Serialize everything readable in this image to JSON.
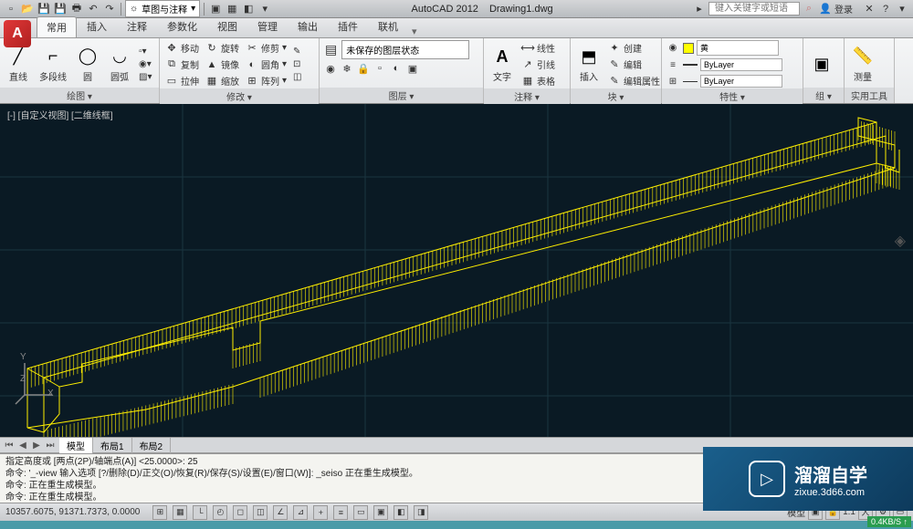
{
  "app": {
    "name": "AutoCAD 2012",
    "file": "Drawing1.dwg"
  },
  "qat": {
    "workspace": "草图与注释",
    "search_placeholder": "键入关键字或短语",
    "login": "登录"
  },
  "tabs": [
    {
      "label": "常用",
      "active": true
    },
    {
      "label": "插入",
      "active": false
    },
    {
      "label": "注释",
      "active": false
    },
    {
      "label": "参数化",
      "active": false
    },
    {
      "label": "视图",
      "active": false
    },
    {
      "label": "管理",
      "active": false
    },
    {
      "label": "输出",
      "active": false
    },
    {
      "label": "插件",
      "active": false
    },
    {
      "label": "联机",
      "active": false
    }
  ],
  "panels": {
    "draw": {
      "label": "绘图 ▾",
      "big": [
        {
          "label": "直线"
        },
        {
          "label": "多段线"
        },
        {
          "label": "圆"
        },
        {
          "label": "圆弧"
        }
      ]
    },
    "modify": {
      "label": "修改 ▾",
      "rows": [
        [
          {
            "icon": "✥",
            "label": "移动"
          },
          {
            "icon": "↻",
            "label": "旋转"
          },
          {
            "icon": "✂",
            "label": "修剪"
          }
        ],
        [
          {
            "icon": "⧉",
            "label": "复制"
          },
          {
            "icon": "▲",
            "label": "镜像"
          },
          {
            "icon": "◐",
            "label": "圆角"
          }
        ],
        [
          {
            "icon": "▭",
            "label": "拉伸"
          },
          {
            "icon": "▦",
            "label": "缩放"
          },
          {
            "icon": "⊞",
            "label": "阵列"
          }
        ]
      ]
    },
    "layer": {
      "label": "图层 ▾",
      "current": "未保存的图层状态"
    },
    "annotation": {
      "label": "注释 ▾",
      "text": "文字",
      "rows": [
        {
          "icon": "⟵⟶",
          "label": "线性"
        },
        {
          "icon": "↗",
          "label": "引线"
        },
        {
          "icon": "▦",
          "label": "表格"
        }
      ]
    },
    "block": {
      "label": "块 ▾",
      "insert": "插入",
      "rows": [
        {
          "icon": "✦",
          "label": "创建"
        },
        {
          "icon": "✎",
          "label": "编辑"
        },
        {
          "icon": "✎",
          "label": "编辑属性"
        }
      ]
    },
    "properties": {
      "label": "特性 ▾",
      "color": "黄",
      "layer": "ByLayer",
      "ltype": "ByLayer"
    },
    "group": {
      "label": "组 ▾"
    },
    "utilities": {
      "label": "实用工具",
      "measure": "测量"
    }
  },
  "viewport": {
    "label": "[-] [自定义视图] [二维线框]"
  },
  "model_tabs": [
    {
      "label": "模型",
      "active": true
    },
    {
      "label": "布局1",
      "active": false
    },
    {
      "label": "布局2",
      "active": false
    }
  ],
  "cmd": {
    "l1": "指定高度或 [两点(2P)/轴端点(A)] <25.0000>:  25",
    "l2": "命令: '_-view 输入选项 [?/删除(D)/正交(O)/恢复(R)/保存(S)/设置(E)/窗口(W)]: _seiso 正在重生成模型。",
    "l3": "命令:  正在重生成模型。",
    "l4": "命令:  正在重生成模型。",
    "prompt": "命令:"
  },
  "status": {
    "coords": "10357.6075, 91371.7373,  0.0000",
    "right": {
      "view": "模型",
      "scale": "1:1"
    }
  },
  "watermark": {
    "title": "溜溜自学",
    "url": "zixue.3d66.com"
  },
  "netspeed": "0.4KB/S ↑"
}
